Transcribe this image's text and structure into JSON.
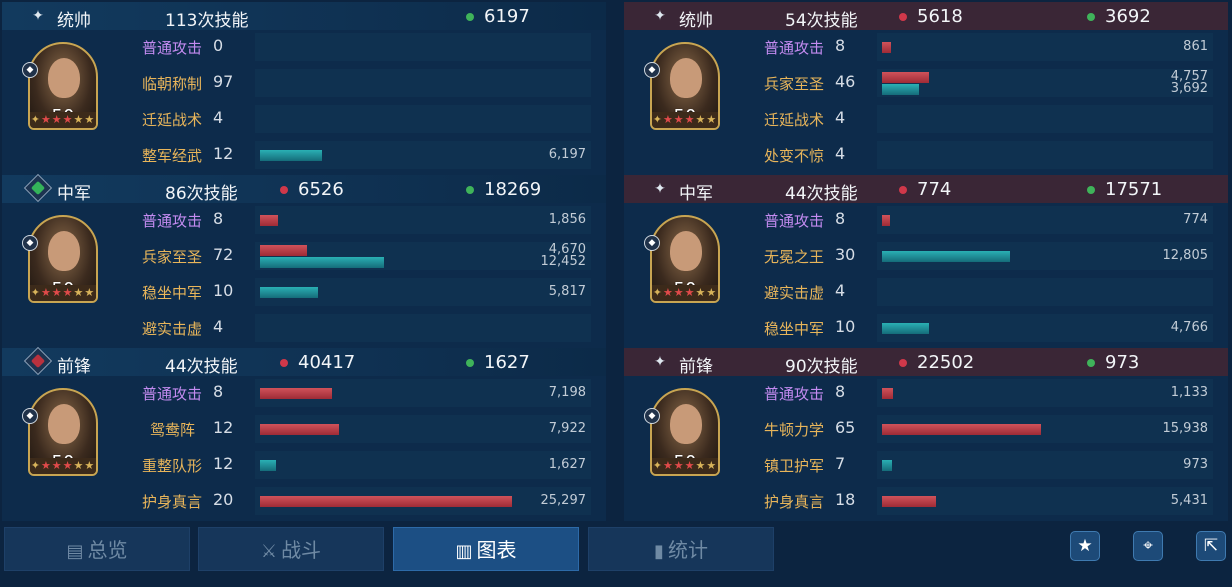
{
  "left": {
    "sections": [
      {
        "role": "统帅",
        "role_icon": "star-icon",
        "skill_count": "113次技能",
        "red": "",
        "green": "6197",
        "level": "50",
        "skills": [
          {
            "name": "普通攻击",
            "level": "0",
            "basic": true,
            "red": null,
            "teal": null,
            "red_label": "",
            "teal_label": ""
          },
          {
            "name": "临朝称制",
            "level": "97",
            "basic": false,
            "red": null,
            "teal": null,
            "red_label": "",
            "teal_label": ""
          },
          {
            "name": "迁延战术",
            "level": "4",
            "basic": false,
            "red": null,
            "teal": null,
            "red_label": "",
            "teal_label": ""
          },
          {
            "name": "整军经武",
            "level": "12",
            "basic": false,
            "red": null,
            "teal": 6197,
            "red_label": "",
            "teal_label": "6,197"
          }
        ]
      },
      {
        "role": "中军",
        "role_icon": "green-diamond-icon",
        "skill_count": "86次技能",
        "red": "6526",
        "green": "18269",
        "level": "50",
        "skills": [
          {
            "name": "普通攻击",
            "level": "8",
            "basic": true,
            "red": 1856,
            "teal": null,
            "red_label": "1,856",
            "teal_label": ""
          },
          {
            "name": "兵家至圣",
            "level": "72",
            "basic": false,
            "red": 4670,
            "teal": 12452,
            "red_label": "4,670",
            "teal_label": "12,452"
          },
          {
            "name": "稳坐中军",
            "level": "10",
            "basic": false,
            "red": null,
            "teal": 5817,
            "red_label": "",
            "teal_label": "5,817"
          },
          {
            "name": "避实击虚",
            "level": "4",
            "basic": false,
            "red": null,
            "teal": null,
            "red_label": "",
            "teal_label": ""
          }
        ]
      },
      {
        "role": "前锋",
        "role_icon": "red-diamond-icon",
        "skill_count": "44次技能",
        "red": "40417",
        "green": "1627",
        "level": "50",
        "skills": [
          {
            "name": "普通攻击",
            "level": "8",
            "basic": true,
            "red": 7198,
            "teal": null,
            "red_label": "7,198",
            "teal_label": ""
          },
          {
            "name": "鸳鸯阵",
            "level": "12",
            "basic": false,
            "red": 7922,
            "teal": null,
            "red_label": "7,922",
            "teal_label": ""
          },
          {
            "name": "重整队形",
            "level": "12",
            "basic": false,
            "red": null,
            "teal": 1627,
            "red_label": "",
            "teal_label": "1,627"
          },
          {
            "name": "护身真言",
            "level": "20",
            "basic": false,
            "red": 25297,
            "teal": null,
            "red_label": "25,297",
            "teal_label": ""
          }
        ]
      }
    ]
  },
  "right": {
    "sections": [
      {
        "role": "统帅",
        "role_icon": "star-icon",
        "skill_count": "54次技能",
        "red": "5618",
        "green": "3692",
        "level": "50",
        "skills": [
          {
            "name": "普通攻击",
            "level": "8",
            "basic": true,
            "red": 861,
            "teal": null,
            "red_label": "861",
            "teal_label": ""
          },
          {
            "name": "兵家至圣",
            "level": "46",
            "basic": false,
            "red": 4757,
            "teal": 3692,
            "red_label": "4,757",
            "teal_label": "3,692"
          },
          {
            "name": "迁延战术",
            "level": "4",
            "basic": false,
            "red": null,
            "teal": null,
            "red_label": "",
            "teal_label": ""
          },
          {
            "name": "处变不惊",
            "level": "4",
            "basic": false,
            "red": null,
            "teal": null,
            "red_label": "",
            "teal_label": ""
          }
        ]
      },
      {
        "role": "中军",
        "role_icon": "star-icon",
        "skill_count": "44次技能",
        "red": "774",
        "green": "17571",
        "level": "50",
        "skills": [
          {
            "name": "普通攻击",
            "level": "8",
            "basic": true,
            "red": 774,
            "teal": null,
            "red_label": "774",
            "teal_label": ""
          },
          {
            "name": "无冕之王",
            "level": "30",
            "basic": false,
            "red": null,
            "teal": 12805,
            "red_label": "",
            "teal_label": "12,805"
          },
          {
            "name": "避实击虚",
            "level": "4",
            "basic": false,
            "red": null,
            "teal": null,
            "red_label": "",
            "teal_label": ""
          },
          {
            "name": "稳坐中军",
            "level": "10",
            "basic": false,
            "red": null,
            "teal": 4766,
            "red_label": "",
            "teal_label": "4,766"
          }
        ]
      },
      {
        "role": "前锋",
        "role_icon": "star-icon",
        "skill_count": "90次技能",
        "red": "22502",
        "green": "973",
        "level": "50",
        "skills": [
          {
            "name": "普通攻击",
            "level": "8",
            "basic": true,
            "red": 1133,
            "teal": null,
            "red_label": "1,133",
            "teal_label": ""
          },
          {
            "name": "牛顿力学",
            "level": "65",
            "basic": false,
            "red": 15938,
            "teal": null,
            "red_label": "15,938",
            "teal_label": ""
          },
          {
            "name": "镇卫护军",
            "level": "7",
            "basic": false,
            "red": null,
            "teal": 973,
            "red_label": "",
            "teal_label": "973"
          },
          {
            "name": "护身真言",
            "level": "18",
            "basic": false,
            "red": 5431,
            "teal": null,
            "red_label": "5,431",
            "teal_label": ""
          }
        ]
      }
    ]
  },
  "bar_scale_max": 25297,
  "tabs": [
    {
      "label": "总览",
      "icon": "document-icon",
      "active": false
    },
    {
      "label": "战斗",
      "icon": "crossed-swords-icon",
      "active": false
    },
    {
      "label": "图表",
      "icon": "chart-icon",
      "active": true
    },
    {
      "label": "统计",
      "icon": "bar-stats-icon",
      "active": false
    }
  ],
  "tools": [
    {
      "icon": "star-icon",
      "glyph": "★"
    },
    {
      "icon": "location-pin-icon",
      "glyph": "⌖"
    },
    {
      "icon": "share-icon",
      "glyph": "⇱"
    }
  ],
  "colors": {
    "red_bar": "#c0404c",
    "teal_bar": "#1f9aa4",
    "red_dot": "#d0384a",
    "green_dot": "#3fb35a",
    "active_tab": "#1c4f84"
  }
}
